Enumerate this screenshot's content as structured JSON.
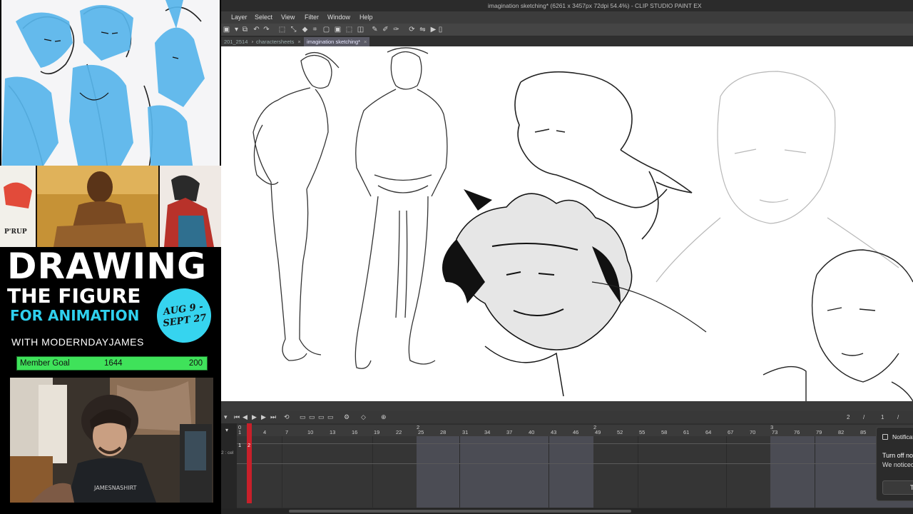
{
  "stream": {
    "promo": {
      "line1": "DRAWING",
      "line2": "THE FIGURE",
      "line3": "FOR ANIMATION",
      "host": "WITH MODERNDAYJAMES",
      "date_line1": "AUG 9 -",
      "date_line2": "SEPT 27"
    },
    "member_goal": {
      "label": "Member Goal",
      "current": "1644",
      "target": "200",
      "fill_fraction": 1.0
    },
    "strip_art_text": "P'RUP",
    "shirt_text": "JAMESNASHIRT"
  },
  "app": {
    "title": "imagination sketching* (6261 x 3457px 72dpi 54.4%) - CLIP STUDIO PAINT EX",
    "menu": [
      "Layer",
      "Select",
      "View",
      "Filter",
      "Window",
      "Help"
    ],
    "tabs": [
      {
        "label": "201_2514",
        "active": false
      },
      {
        "label": "charactersheets",
        "active": false
      },
      {
        "label": "imagination sketching*",
        "active": true
      }
    ],
    "tab_close": "×",
    "accent": "#c8202a"
  },
  "timeline": {
    "frame_ticks": [
      "4",
      "7",
      "10",
      "13",
      "16",
      "19",
      "22",
      "25",
      "28",
      "31",
      "34",
      "37",
      "40",
      "43",
      "46",
      "49",
      "52",
      "55",
      "58",
      "61",
      "64",
      "67",
      "70",
      "73",
      "76",
      "79",
      "82",
      "85"
    ],
    "markers": [
      "0",
      "1",
      "2",
      "2",
      "3"
    ],
    "current_frame": "2",
    "row_label": "2 : cel",
    "cel_values": [
      "1",
      "2"
    ],
    "page_indicator": [
      "2",
      "/",
      "1",
      "/"
    ]
  },
  "notification": {
    "title": "Notifications",
    "heading": "Turn off notifications",
    "body": "We noticed",
    "button": "Turn off"
  }
}
